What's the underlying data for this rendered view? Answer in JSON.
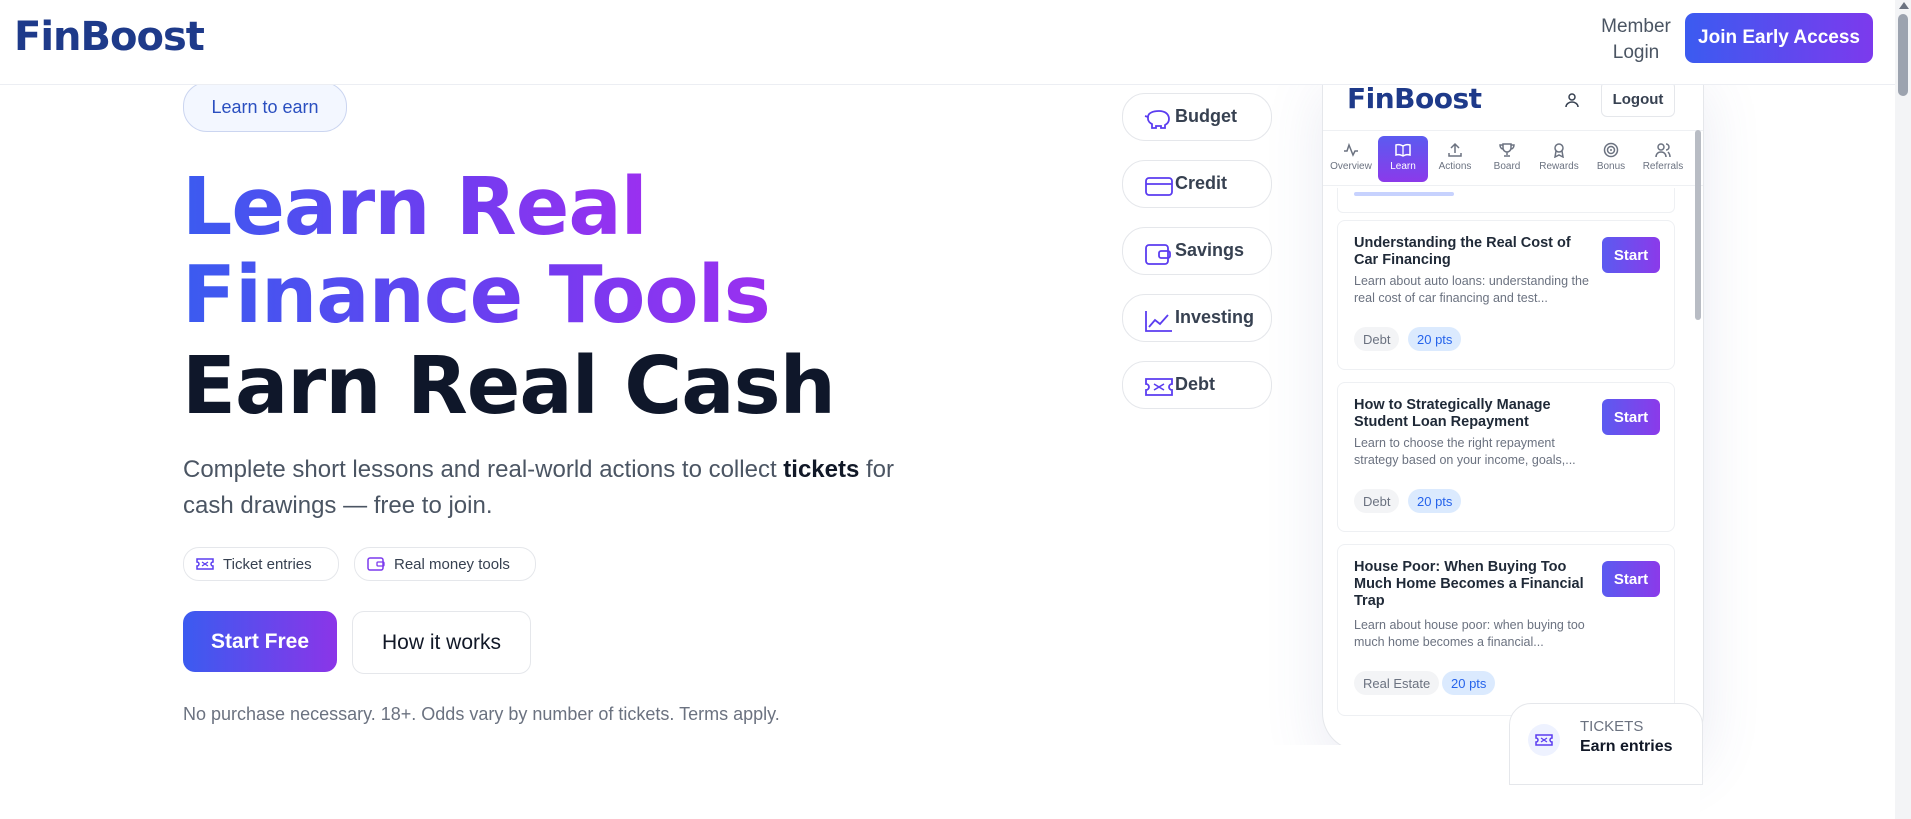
{
  "header": {
    "logo": "FinBoost",
    "member_login_line1": "Member",
    "member_login_line2": "Login",
    "join_button": "Join Early Access"
  },
  "hero": {
    "pill": "Learn to earn",
    "headline_line1": "Learn Real",
    "headline_line2": "Finance Tools",
    "headline_line3": "Earn Real Cash",
    "subtitle_before": "Complete short lessons and real-world actions to collect ",
    "subtitle_bold": "tickets",
    "subtitle_after": " for cash drawings — free to join.",
    "chips": [
      "Ticket entries",
      "Real money tools"
    ],
    "primary_button": "Start Free",
    "secondary_button": "How it works",
    "disclaimer": "No purchase necessary. 18+. Odds vary by number of tickets. Terms apply."
  },
  "categories": [
    {
      "label": "Budget",
      "icon": "piggy-bank-icon"
    },
    {
      "label": "Credit",
      "icon": "credit-card-icon"
    },
    {
      "label": "Savings",
      "icon": "wallet-icon"
    },
    {
      "label": "Investing",
      "icon": "chart-line-icon"
    },
    {
      "label": "Debt",
      "icon": "ticket-icon"
    }
  ],
  "phone": {
    "logo": "FinBoost",
    "logout": "Logout",
    "nav": [
      {
        "label": "Overview",
        "icon": "activity-icon"
      },
      {
        "label": "Learn",
        "icon": "book-icon",
        "active": true
      },
      {
        "label": "Actions",
        "icon": "upload-icon"
      },
      {
        "label": "Board",
        "icon": "trophy-icon"
      },
      {
        "label": "Rewards",
        "icon": "award-icon"
      },
      {
        "label": "Bonus",
        "icon": "target-icon"
      },
      {
        "label": "Referrals",
        "icon": "users-icon"
      }
    ],
    "lessons": [
      {
        "title": "Understanding the Real Cost of Car Financing",
        "desc": "Learn about auto loans: understanding the real cost of car financing and test...",
        "tag": "Debt",
        "points": "20 pts",
        "button": "Start"
      },
      {
        "title": "How to Strategically Manage Student Loan Repayment",
        "desc": "Learn to choose the right repayment strategy based on your income, goals,...",
        "tag": "Debt",
        "points": "20 pts",
        "button": "Start"
      },
      {
        "title": "House Poor: When Buying Too Much Home Becomes a Financial Trap",
        "desc": "Learn about house poor: when buying too much home becomes a financial...",
        "tag": "Real Estate",
        "points": "20 pts",
        "button": "Start"
      }
    ],
    "tickets_label": "TICKETS",
    "tickets_value": "Earn entries"
  },
  "colors": {
    "brand_navy": "#1e3a8a",
    "gradient_start": "#3b5bf0",
    "gradient_end": "#8b35e8",
    "text_muted": "#6b7280"
  }
}
